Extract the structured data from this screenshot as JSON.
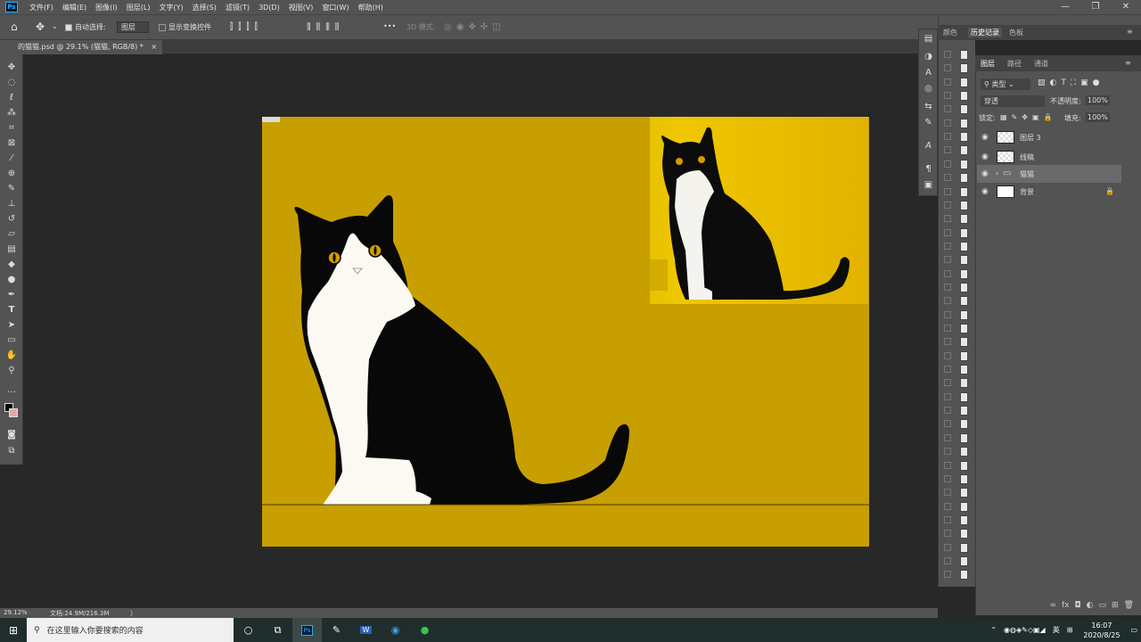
{
  "menu": {
    "items": [
      "文件(F)",
      "编辑(E)",
      "图像(I)",
      "图层(L)",
      "文字(Y)",
      "选择(S)",
      "滤镜(T)",
      "3D(D)",
      "视图(V)",
      "窗口(W)",
      "帮助(H)"
    ],
    "logo": "Ps"
  },
  "window_controls": [
    "—",
    "❐",
    "✕"
  ],
  "options": {
    "auto_select_label": "自动选择:",
    "auto_select_value": "图层",
    "show_transform_label": "显示变换控件",
    "more": "•••",
    "mode_3d_label": "3D 模式:"
  },
  "document_tab": {
    "title": "的猫猫.psd @ 29.1% (猫猫, RGB/8) *",
    "close": "×"
  },
  "status": {
    "zoom": "29.12%",
    "doc_info": "文档:24.9M/216.3M",
    "arrow": "〉"
  },
  "panels": {
    "color_tabs": [
      "颜色",
      "历史记录",
      "色板"
    ],
    "layer_tabs": [
      "图层",
      "路径",
      "通道"
    ],
    "filter_label": "类型",
    "blend_mode": "穿透",
    "opacity_label": "不透明度:",
    "opacity_value": "100%",
    "lock_label": "锁定:",
    "fill_label": "填充:",
    "fill_value": "100%"
  },
  "layers": [
    {
      "name": "图层 3",
      "visible": true,
      "selected": false
    },
    {
      "name": "线稿",
      "visible": true,
      "selected": false
    },
    {
      "name": "猫猫",
      "visible": true,
      "selected": true,
      "group": true
    },
    {
      "name": "背景",
      "visible": true,
      "selected": false,
      "locked": true
    }
  ],
  "colors": {
    "canvas_bg": "#c89f00",
    "cat_black": "#080808",
    "cat_white": "#fbf9f2",
    "eye": "#d49a00",
    "ps_blue": "#31a8ff"
  },
  "taskbar": {
    "search_placeholder": "在这里输入你要搜索的内容",
    "ime": "英",
    "time": "16:07",
    "date": "2020/8/25"
  }
}
